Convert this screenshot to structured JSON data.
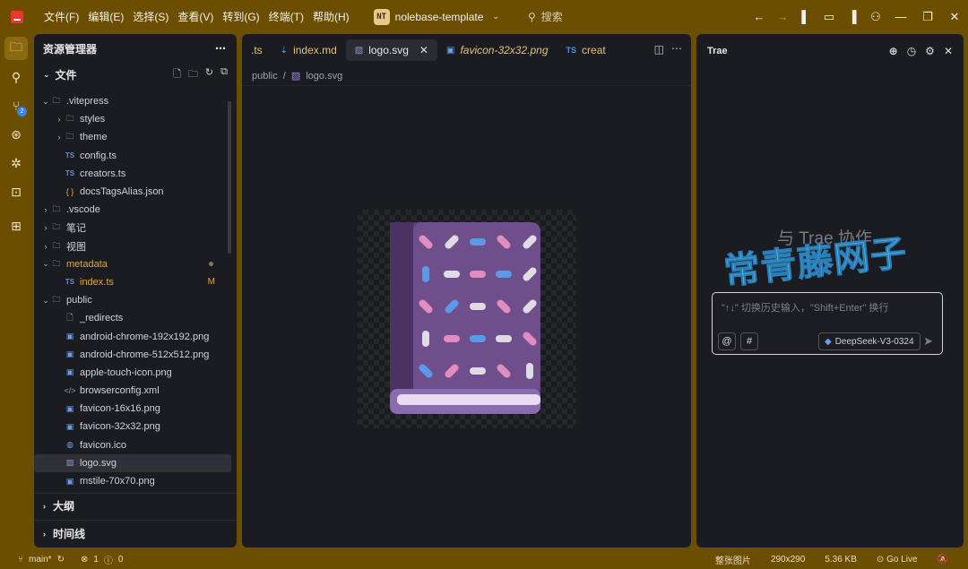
{
  "menu": [
    "文件(F)",
    "编辑(E)",
    "选择(S)",
    "查看(V)",
    "转到(G)",
    "终端(T)",
    "帮助(H)"
  ],
  "project": {
    "badge": "NT",
    "name": "nolebase-template"
  },
  "search_placeholder": "搜索",
  "explorer": {
    "title": "资源管理器",
    "section": "文件",
    "outline": "大纲",
    "timeline": "时间线",
    "tree": [
      {
        "name": ".vitepress",
        "type": "folder",
        "open": true,
        "depth": 0
      },
      {
        "name": "styles",
        "type": "folder",
        "open": false,
        "depth": 1
      },
      {
        "name": "theme",
        "type": "folder",
        "open": false,
        "depth": 1
      },
      {
        "name": "config.ts",
        "type": "ts",
        "depth": 1
      },
      {
        "name": "creators.ts",
        "type": "ts",
        "depth": 1
      },
      {
        "name": "docsTagsAlias.json",
        "type": "json",
        "depth": 1
      },
      {
        "name": ".vscode",
        "type": "folder",
        "open": false,
        "depth": 0
      },
      {
        "name": "笔记",
        "type": "folder",
        "open": false,
        "depth": 0
      },
      {
        "name": "视图",
        "type": "folder",
        "open": false,
        "depth": 0
      },
      {
        "name": "metadata",
        "type": "folder",
        "open": true,
        "depth": 0,
        "modified": "dot"
      },
      {
        "name": "index.ts",
        "type": "ts",
        "depth": 1,
        "modified": "M"
      },
      {
        "name": "public",
        "type": "folder",
        "open": true,
        "depth": 0
      },
      {
        "name": "_redirects",
        "type": "file",
        "depth": 1
      },
      {
        "name": "android-chrome-192x192.png",
        "type": "img",
        "depth": 1
      },
      {
        "name": "android-chrome-512x512.png",
        "type": "img",
        "depth": 1
      },
      {
        "name": "apple-touch-icon.png",
        "type": "img",
        "depth": 1
      },
      {
        "name": "browserconfig.xml",
        "type": "xml",
        "depth": 1
      },
      {
        "name": "favicon-16x16.png",
        "type": "img",
        "depth": 1
      },
      {
        "name": "favicon-32x32.png",
        "type": "img",
        "depth": 1
      },
      {
        "name": "favicon.ico",
        "type": "ico",
        "depth": 1
      },
      {
        "name": "logo.svg",
        "type": "svg",
        "depth": 1,
        "selected": true
      },
      {
        "name": "mstile-70x70.png",
        "type": "img",
        "depth": 1
      }
    ]
  },
  "editor": {
    "tabs": [
      {
        "label": ".ts",
        "icon": "",
        "style": "plain"
      },
      {
        "label": "index.md",
        "icon": "download-arrow-icon",
        "style": "plain"
      },
      {
        "label": "logo.svg",
        "icon": "svg-icon",
        "style": "active"
      },
      {
        "label": "favicon-32x32.png",
        "icon": "image-icon",
        "style": "italic"
      },
      {
        "label": "creat",
        "icon": "TS",
        "style": "plain"
      }
    ],
    "breadcrumb": [
      "public",
      "logo.svg"
    ]
  },
  "chat": {
    "title": "Trae",
    "welcome": "与 Trae 协作",
    "watermark": "常青藤网子",
    "placeholder": "\"↑↓\" 切换历史输入，\"Shift+Enter\" 换行",
    "at": "@",
    "hash": "#",
    "model": "DeepSeek-V3-0324"
  },
  "statusbar": {
    "branch": "main*",
    "errors": "1",
    "warnings": "0",
    "fit": "整张图片",
    "dims": "290x290",
    "size": "5.36 KB",
    "golive": "Go Live"
  }
}
